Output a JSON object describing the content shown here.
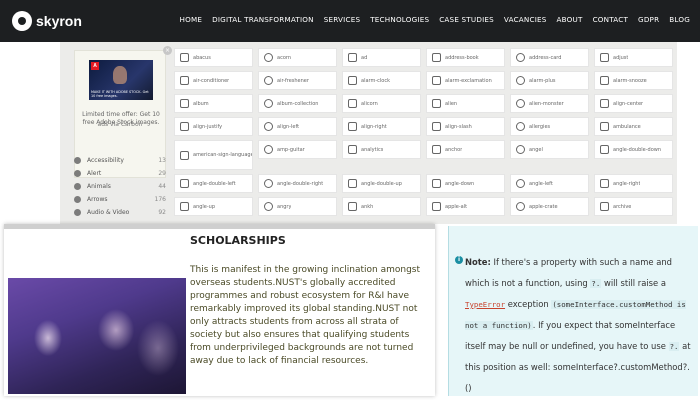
{
  "header": {
    "brand": "skyron",
    "nav": [
      "HOME",
      "DIGITAL TRANSFORMATION",
      "SERVICES",
      "TECHNOLOGIES",
      "CASE STUDIES",
      "VACANCIES",
      "ABOUT",
      "CONTACT",
      "GDPR",
      "BLOG"
    ],
    "colors": {
      "background": "#1d1f21",
      "text": "#ffffff"
    }
  },
  "icon_browser": {
    "promo": {
      "close": "×",
      "image_text": "MAKE IT WITH ADOBE STOCK. Get 10 free images.",
      "text": "Limited time offer: Get 10 free Adobe Stock images.",
      "by": "ads via Carbon"
    },
    "categories": [
      {
        "label": "Accessibility",
        "count": "13"
      },
      {
        "label": "Alert",
        "count": "29"
      },
      {
        "label": "Animals",
        "count": "44"
      },
      {
        "label": "Arrows",
        "count": "176"
      },
      {
        "label": "Audio & Video",
        "count": "92"
      }
    ],
    "tiles": [
      {
        "icon": "grid-icon",
        "label": "abacus"
      },
      {
        "icon": "bowl-icon",
        "label": "acorn"
      },
      {
        "icon": "ad-icon",
        "label": "ad"
      },
      {
        "icon": "card-icon",
        "label": "address-book"
      },
      {
        "icon": "card-icon",
        "label": "address-card"
      },
      {
        "icon": "adjust-icon",
        "label": "adjust"
      },
      {
        "icon": "air-icon",
        "label": "air-conditioner"
      },
      {
        "icon": "air-icon",
        "label": "air-freshener"
      },
      {
        "icon": "clock-icon",
        "label": "alarm-clock"
      },
      {
        "icon": "clock-icon",
        "label": "alarm-exclamation"
      },
      {
        "icon": "clock-icon",
        "label": "alarm-plus"
      },
      {
        "icon": "clock-icon",
        "label": "alarm-snooze"
      },
      {
        "icon": "album-icon",
        "label": "album"
      },
      {
        "icon": "album-icon",
        "label": "album-collection"
      },
      {
        "icon": "alicorn-icon",
        "label": "alicorn"
      },
      {
        "icon": "alien-icon",
        "label": "alien"
      },
      {
        "icon": "alien-icon",
        "label": "alien-monster"
      },
      {
        "icon": "align-icon",
        "label": "align-center"
      },
      {
        "icon": "align-icon",
        "label": "align-justify"
      },
      {
        "icon": "align-icon",
        "label": "align-left"
      },
      {
        "icon": "align-icon",
        "label": "align-right"
      },
      {
        "icon": "align-icon",
        "label": "align-slash"
      },
      {
        "icon": "allergies-icon",
        "label": "allergies"
      },
      {
        "icon": "ambulance-icon",
        "label": "ambulance"
      },
      {
        "icon": "asl-icon",
        "label": "american-sign-language-interpreting"
      },
      {
        "icon": "amp-icon",
        "label": "amp-guitar"
      },
      {
        "icon": "chart-icon",
        "label": "analytics"
      },
      {
        "icon": "anchor-icon",
        "label": "anchor"
      },
      {
        "icon": "angel-icon",
        "label": "angel"
      },
      {
        "icon": "angle-icon",
        "label": "angle-double-down"
      },
      {
        "icon": "angle-icon",
        "label": "angle-double-left"
      },
      {
        "icon": "angle-icon",
        "label": "angle-double-right"
      },
      {
        "icon": "angle-icon",
        "label": "angle-double-up"
      },
      {
        "icon": "angle-icon",
        "label": "angle-down"
      },
      {
        "icon": "angle-icon",
        "label": "angle-left"
      },
      {
        "icon": "angle-icon",
        "label": "angle-right"
      },
      {
        "icon": "angle-icon",
        "label": "angle-up"
      },
      {
        "icon": "angry-icon",
        "label": "angry"
      },
      {
        "icon": "ankh-icon",
        "label": "ankh"
      },
      {
        "icon": "apple-icon",
        "label": "apple-alt"
      },
      {
        "icon": "crate-icon",
        "label": "apple-crate"
      },
      {
        "icon": "archive-icon",
        "label": "archive"
      }
    ]
  },
  "scholarships": {
    "title": "SCHOLARSHIPS",
    "body": "This is manifest in the growing inclination amongst overseas students.NUST's globally accredited programmes and robust ecosystem for R&I have remarkably improved its global standing.NUST not only attracts students from across all strata of society but also ensures that qualifying students from underprivileged backgrounds are not turned away due to lack of financial resources."
  },
  "note": {
    "icon": "i",
    "label": "Note:",
    "text_1": "If there's a property with such a name and which is not a function, using",
    "code_1": "?.",
    "text_2": "will still raise a",
    "link": "TypeError",
    "text_3": "exception",
    "code_2": "(someInterface.customMethod is not a function)",
    "text_4": ". If you expect that someInterface itself may be null or undefined, you have to use",
    "code_3": "?.",
    "text_5": "at this position as well: someInterface?.customMethod?.()"
  }
}
